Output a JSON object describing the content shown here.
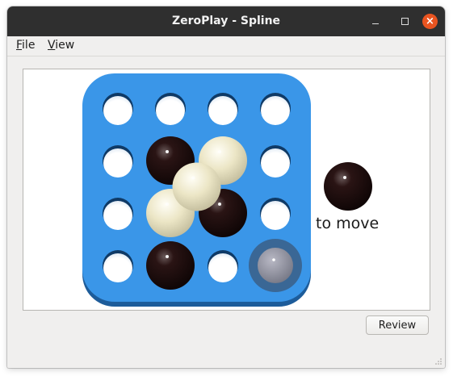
{
  "window": {
    "title": "ZeroPlay - Spline"
  },
  "menu": {
    "file_mnemonic": "F",
    "file_rest": "ile",
    "view_mnemonic": "V",
    "view_rest": "iew"
  },
  "game": {
    "name": "Spline",
    "board_size": 4,
    "to_move_label": "to move",
    "next_player": "black",
    "board_color": "#3a96e8",
    "black_stone_color": "#1a0a0a",
    "white_stone_color": "#efeacb",
    "level1_stones": [
      {
        "row": 1,
        "col": 1,
        "color": "black"
      },
      {
        "row": 1,
        "col": 2,
        "color": "white"
      },
      {
        "row": 2,
        "col": 1,
        "color": "white"
      },
      {
        "row": 2,
        "col": 2,
        "color": "black"
      },
      {
        "row": 3,
        "col": 1,
        "color": "black"
      },
      {
        "row": 3,
        "col": 3,
        "color": "ghost"
      }
    ],
    "level2_stones": [
      {
        "row": 1,
        "col": 1,
        "color": "white"
      }
    ]
  },
  "buttons": {
    "review_label": "Review"
  }
}
